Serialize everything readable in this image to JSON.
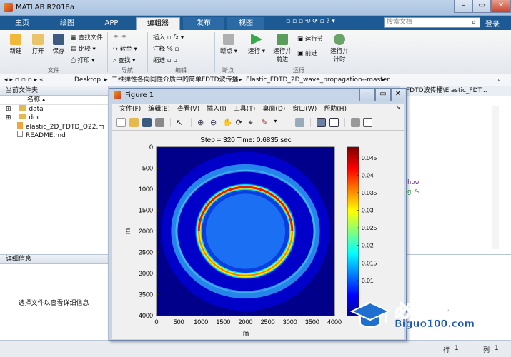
{
  "app": {
    "title": "MATLAB R2018a",
    "tabs": [
      "主页",
      "绘图",
      "APP",
      "编辑器",
      "发布",
      "视图"
    ],
    "active_tab": "编辑器",
    "search_placeholder": "搜索文档",
    "login": "登录"
  },
  "ribbon": {
    "file": {
      "new": "新建",
      "open": "打开",
      "save": "保存",
      "find_files": "查找文件",
      "compare": "比较",
      "print": "打印",
      "group": "文件"
    },
    "nav": {
      "goto": "转至",
      "find": "查找",
      "group": "导航"
    },
    "edit": {
      "insert": "插入",
      "comment": "注释",
      "indent": "缩进",
      "fx": "fx",
      "group": "编辑"
    },
    "breakpoints": {
      "label": "断点",
      "group": "断点"
    },
    "run": {
      "run": "运行",
      "run_advance": "运行并\n前进",
      "run_section": "运行节",
      "advance": "前进",
      "run_time": "运行并\n计时",
      "group": "运行"
    }
  },
  "address": {
    "segments": [
      "Desktop",
      "二维弹性各向同性介质中的简单FDTD波传播",
      "Elastic_FDTD_2D_wave_propagation--master"
    ]
  },
  "files": {
    "header": "当前文件夹",
    "col_name": "名称",
    "items": [
      {
        "name": "data",
        "type": "folder"
      },
      {
        "name": "doc",
        "type": "folder"
      },
      {
        "name": "elastic_2D_FDTD_O22.m",
        "type": "mfile"
      },
      {
        "name": "README.md",
        "type": "file"
      }
    ]
  },
  "details": {
    "header": "详细信息",
    "hint": "选择文件以查看详细信息"
  },
  "editor": {
    "path": "FDTD波传播\\Elastic_FDT...",
    "line1": "how",
    "line2": "g %"
  },
  "status": {
    "row_label": "行",
    "row": "1",
    "col_label": "列",
    "col": "1"
  },
  "figure": {
    "title": "Figure 1",
    "menu": [
      "文件(F)",
      "编辑(E)",
      "查看(V)",
      "插入(I)",
      "工具(T)",
      "桌面(D)",
      "窗口(W)",
      "帮助(H)"
    ]
  },
  "chart_data": {
    "type": "heatmap",
    "title": "Step = 320 Time: 0.6835 sec",
    "xlabel": "m",
    "ylabel": "m",
    "xlim": [
      0,
      4000
    ],
    "ylim": [
      0,
      4000
    ],
    "x_ticks": [
      0,
      500,
      1000,
      1500,
      2000,
      2500,
      3000,
      3500,
      4000
    ],
    "y_ticks": [
      0,
      500,
      1000,
      1500,
      2000,
      2500,
      3000,
      3500,
      4000
    ],
    "colorbar_ticks": [
      0.01,
      0.015,
      0.02,
      0.025,
      0.03,
      0.035,
      0.04,
      0.045
    ],
    "colorbar_range": [
      0,
      0.048
    ],
    "colormap": "jet",
    "y_reversed": true,
    "features": [
      {
        "kind": "ring",
        "center_x": 2000,
        "center_y": 2000,
        "radius": 1050,
        "peak": 0.048
      },
      {
        "kind": "ring",
        "center_x": 2000,
        "center_y": 2000,
        "radius": 1600,
        "peak": 0.02
      }
    ]
  },
  "watermark": {
    "cn": "必过源码",
    "url": "Biguo100.com"
  }
}
